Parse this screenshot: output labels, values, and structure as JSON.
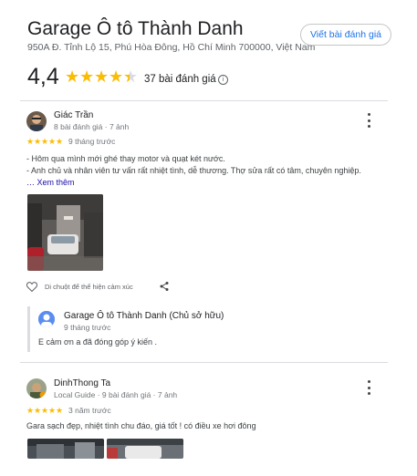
{
  "place": {
    "name": "Garage Ô tô Thành Danh",
    "address": "950A Đ. Tỉnh Lộ 15, Phú Hòa Đông, Hồ Chí Minh 700000, Việt Nam",
    "write_review_label": "Viết bài đánh giá",
    "rating": "4,4",
    "rating_value": 4.4,
    "review_count": "37 bài đánh giá"
  },
  "reviews": [
    {
      "author": "Giác Trần",
      "meta": "8 bài đánh giá · 7 ảnh",
      "stars": 5,
      "time": "9 tháng trước",
      "lines": [
        "- Hôm qua mình mới ghé thay motor và quạt két nước.",
        "- Anh chủ và nhân viên tư vấn rất nhiệt tình, dễ thương. Thợ sửa rất có tâm, chuyên nghiệp."
      ],
      "more_label": "Xem thêm",
      "like_hint": "Di chuột để thể hiện cảm xúc",
      "owner_reply": {
        "author": "Garage Ô tô Thành Danh (Chủ sở hữu)",
        "time": "9 tháng trước",
        "text": "E cảm ơn a đã đóng góp ý kiến ."
      }
    },
    {
      "author": "DinhThong Ta",
      "meta": "Local Guide · 9 bài đánh giá · 7 ảnh",
      "stars": 5,
      "time": "3 năm trước",
      "text": "Gara sạch đẹp, nhiệt tình chu đáo, giá tốt ! có điều xe hơi đông"
    }
  ],
  "colors": {
    "star": "#fbbc04",
    "link": "#1a73e8",
    "more_link": "#1a0dab"
  },
  "icons": [
    "info-icon",
    "more-vert-icon",
    "heart-icon",
    "share-icon"
  ]
}
